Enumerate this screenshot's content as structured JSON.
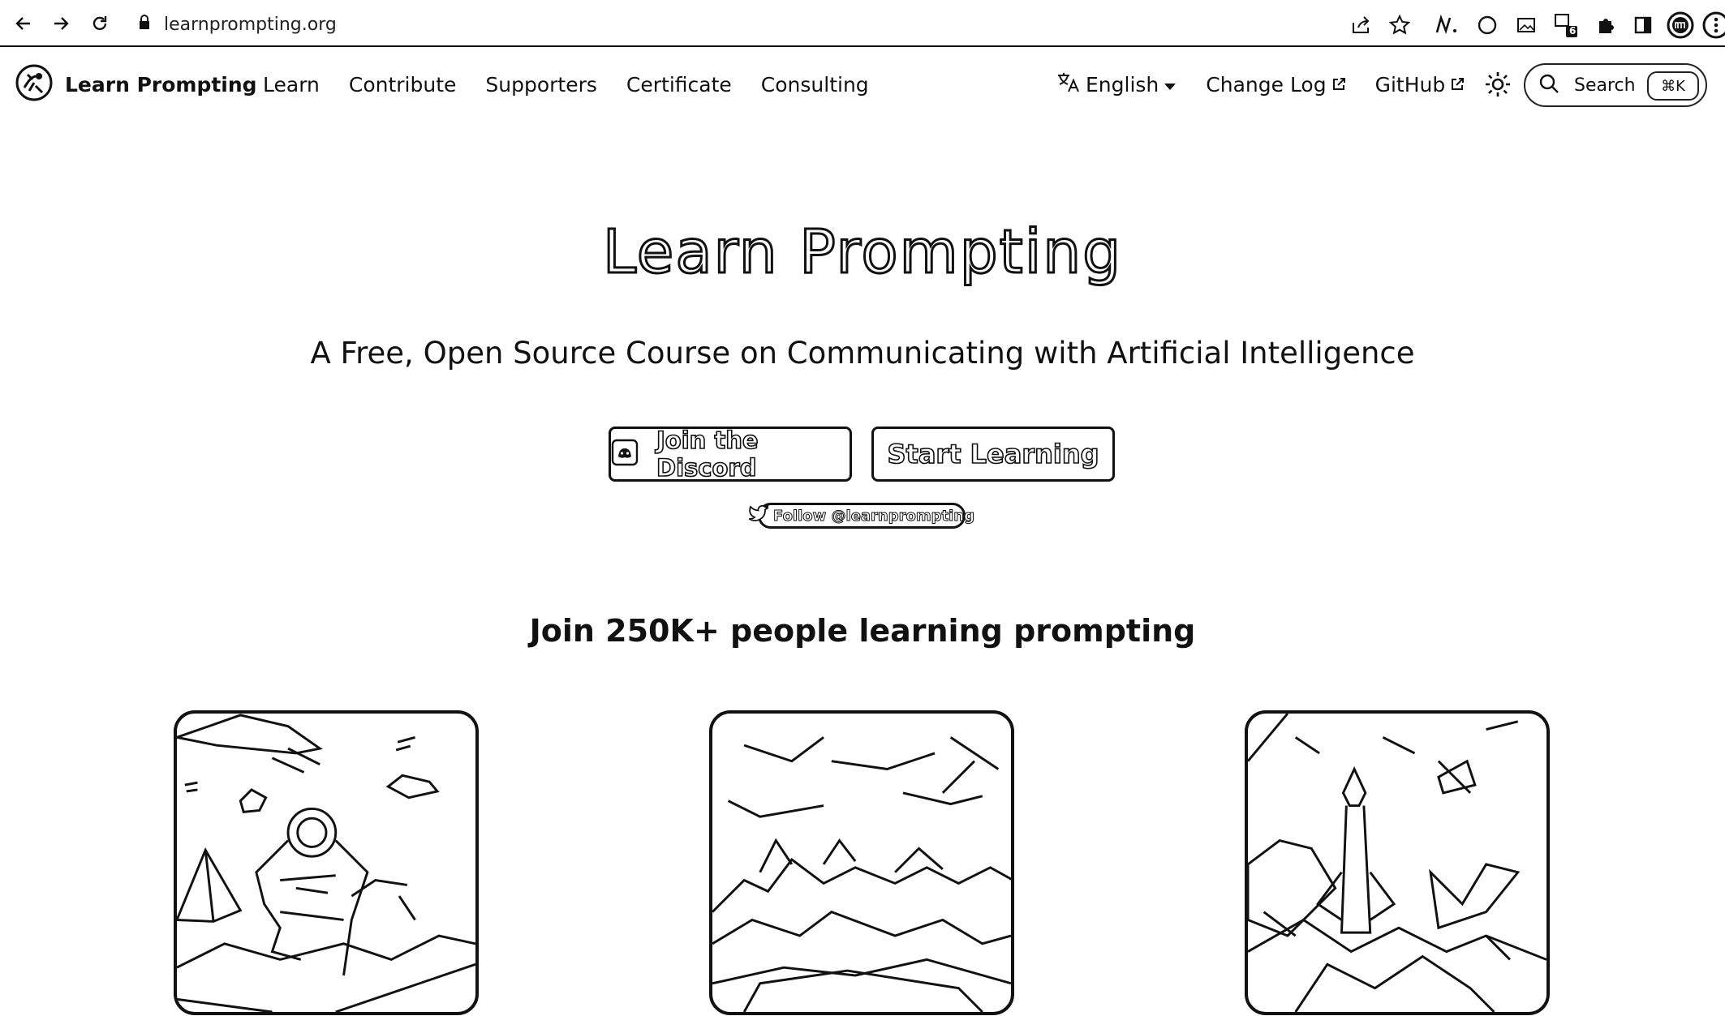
{
  "browser": {
    "url": "learnprompting.org",
    "extension_badge": "6"
  },
  "nav": {
    "brand": "Learn Prompting",
    "links": [
      "Learn",
      "Contribute",
      "Supporters",
      "Certificate",
      "Consulting"
    ],
    "language": "English",
    "changelog": "Change Log",
    "github": "GitHub",
    "search_label": "Search",
    "search_shortcut": "⌘K"
  },
  "hero": {
    "title": "Learn Prompting",
    "subtitle": "A Free, Open Source Course on Communicating with Artificial Intelligence",
    "discord_button": "Join the Discord",
    "start_button": "Start Learning",
    "twitter_button": "Follow @learnprompting"
  },
  "community": {
    "heading": "Join 250K+ people learning prompting"
  }
}
